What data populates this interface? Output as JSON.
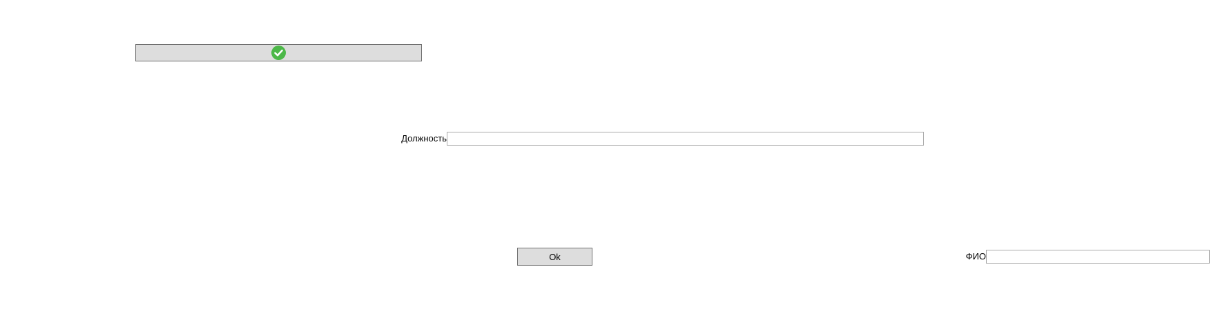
{
  "confirm_button": {
    "icon": "check-circle-icon",
    "icon_color": "#4cb848"
  },
  "position_field": {
    "label": "Должность",
    "value": "",
    "placeholder": ""
  },
  "ok_button": {
    "label": "Ok"
  },
  "fio_field": {
    "label": "ФИО",
    "value": "",
    "placeholder": ""
  },
  "colors": {
    "button_background": "#dddddd",
    "button_border": "#707070",
    "input_border": "#a9a9a9"
  }
}
